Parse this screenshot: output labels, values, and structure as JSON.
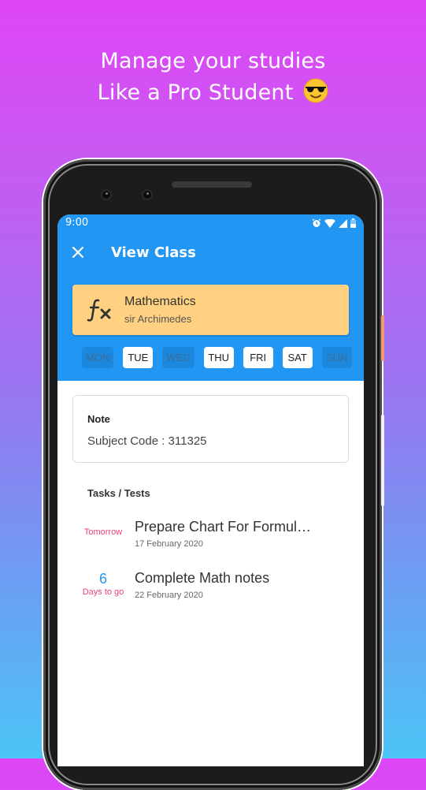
{
  "promo": {
    "line1": "Manage your studies",
    "line2": "Like a Pro Student",
    "emoji": "smiling-face-with-sunglasses"
  },
  "status_bar": {
    "time": "9:00",
    "icons": [
      "alarm-icon",
      "wifi-icon",
      "signal-icon",
      "battery-icon"
    ]
  },
  "toolbar": {
    "title": "View Class",
    "close_icon": "close-icon"
  },
  "class": {
    "icon": "function-fx-icon",
    "name": "Mathematics",
    "teacher": "sir Archimedes",
    "color": "#ffd180"
  },
  "days": [
    {
      "label": "MON",
      "active": false
    },
    {
      "label": "TUE",
      "active": true
    },
    {
      "label": "WED",
      "active": false
    },
    {
      "label": "THU",
      "active": true
    },
    {
      "label": "FRI",
      "active": true
    },
    {
      "label": "SAT",
      "active": true
    },
    {
      "label": "SUN",
      "active": false
    }
  ],
  "note": {
    "label": "Note",
    "text": "Subject Code : 311325"
  },
  "tasks_section": {
    "title": "Tasks / Tests",
    "items": [
      {
        "when_number": "",
        "when_label": "Tomorrow",
        "title": "Prepare Chart For Formul…",
        "date": "17 February 2020"
      },
      {
        "when_number": "6",
        "when_label": "Days to go",
        "title": "Complete Math notes",
        "date": "22 February 2020"
      }
    ]
  },
  "colors": {
    "primary": "#2196f3",
    "accent_pink": "#ec407a",
    "class_card": "#ffd180"
  }
}
